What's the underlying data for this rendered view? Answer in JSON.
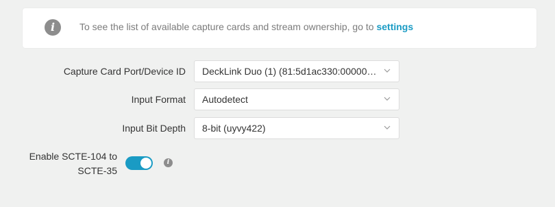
{
  "banner": {
    "icon": "info-icon",
    "icon_glyph": "i",
    "text": "To see the list of available capture cards and stream ownership, go to",
    "link_label": "settings"
  },
  "form": {
    "capture_card": {
      "label": "Capture Card Port/Device ID",
      "value": "DeckLink Duo (1) (81:5d1ac330:00000000)"
    },
    "input_format": {
      "label": "Input Format",
      "value": "Autodetect"
    },
    "input_bit_depth": {
      "label": "Input Bit Depth",
      "value": "8-bit (uyvy422)"
    },
    "scte": {
      "label": "Enable SCTE-104 to\nSCTE-35",
      "enabled": true,
      "info_glyph": "i"
    }
  },
  "colors": {
    "accent": "#1a9bc4",
    "background": "#f0f1f0",
    "icon_gray": "#8d8d8d"
  }
}
